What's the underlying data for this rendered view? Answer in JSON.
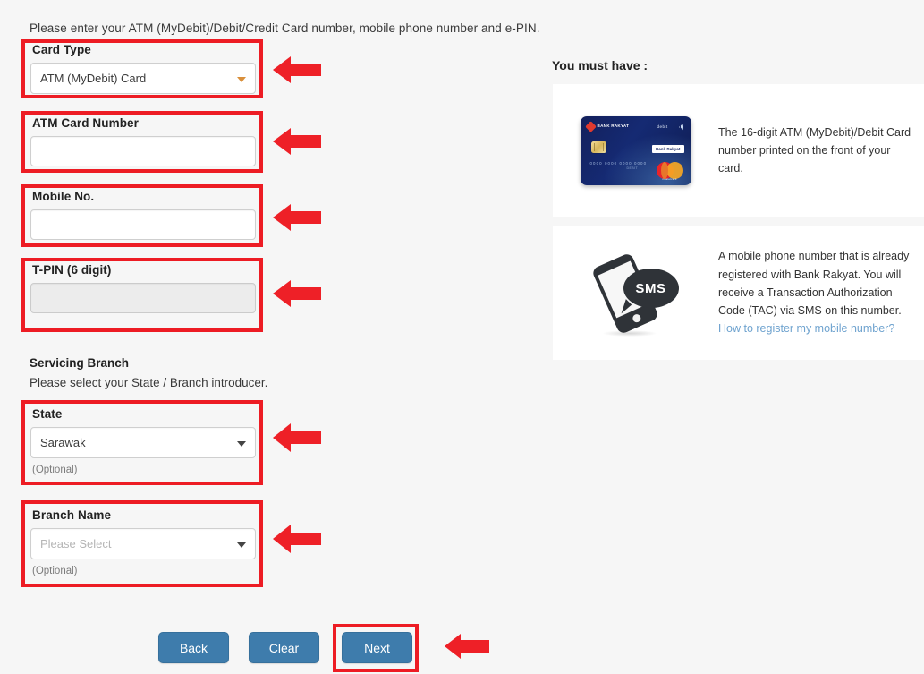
{
  "intro": {
    "instruction": "Please enter your ATM (MyDebit)/Debit/Credit Card number, mobile phone number and e-PIN."
  },
  "form": {
    "card_type": {
      "label": "Card Type",
      "value": "ATM (MyDebit) Card"
    },
    "atm_card_number": {
      "label": "ATM Card Number",
      "value": "",
      "placeholder": ""
    },
    "mobile_no": {
      "label": "Mobile No.",
      "value": "",
      "placeholder": ""
    },
    "tpin": {
      "label": "T-PIN (6 digit)",
      "value": "",
      "placeholder": ""
    }
  },
  "servicing_branch": {
    "title": "Servicing Branch",
    "subtitle": "Please select your State / Branch introducer.",
    "state": {
      "label": "State",
      "value": "Sarawak",
      "note": "(Optional)"
    },
    "branch_name": {
      "label": "Branch Name",
      "value": "Please Select",
      "note": "(Optional)"
    }
  },
  "right_panel": {
    "heading": "You must have :",
    "items": [
      {
        "icon": "bank-card-image",
        "text": "The 16-digit ATM (MyDebit)/Debit Card number printed on the front of your card.",
        "card": {
          "brand": "BANK RAKYAT",
          "tagline": "Bank Rakyat",
          "network": "debit",
          "issuer": "Bank Rakyat",
          "masked_number": "0000 0000 0000 0000",
          "mid_text": "DEBIT",
          "scheme": "mastercard"
        }
      },
      {
        "icon": "sms-phone-image",
        "text_before_link": "A mobile phone number that is already registered with Bank Rakyat. You will receive a Transaction Authorization Code (TAC) via SMS on this number. ",
        "link_text": "How to register my mobile number?",
        "sms_label": "SMS"
      }
    ]
  },
  "footer": {
    "back_label": "Back",
    "clear_label": "Clear",
    "next_label": "Next"
  },
  "colors": {
    "highlight_red": "#ed1c24",
    "arrow_red": "#ee2027",
    "button_blue": "#3e7cac",
    "link_blue": "#6fa3cf",
    "page_background": "#f6f6f6",
    "disabled_field": "#ececec"
  }
}
